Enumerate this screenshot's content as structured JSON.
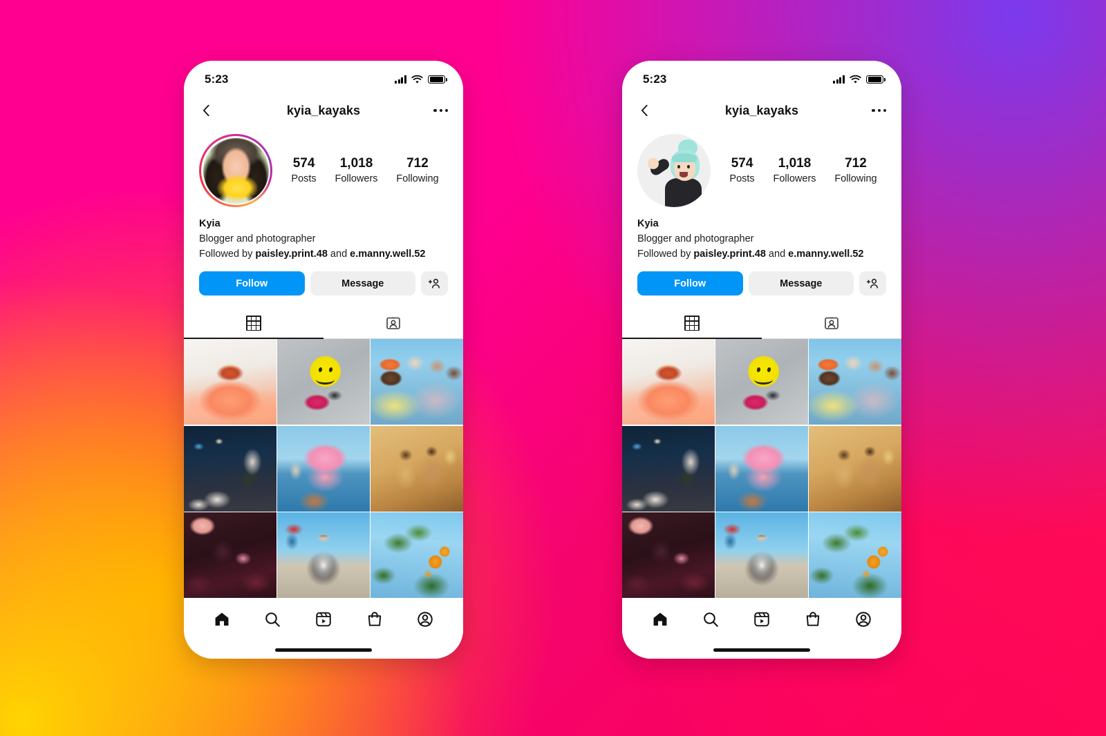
{
  "background": {
    "gradient_colors": [
      "#FF0090",
      "#7B3BEE",
      "#FF0055",
      "#FF8A00",
      "#FFD400"
    ]
  },
  "theme": {
    "follow_button_color": "#0095F6",
    "secondary_button_color": "#EFEFEF",
    "text_color": "#111111",
    "divider_color": "#DBDBDB"
  },
  "status_bar": {
    "time": "5:23",
    "signal_icon": "cellular-signal-icon",
    "wifi_icon": "wifi-icon",
    "battery_icon": "battery-full-icon"
  },
  "nav": {
    "back_icon": "back-chevron-icon",
    "username": "kyia_kayaks",
    "more_icon": "more-options-icon"
  },
  "profile": {
    "name": "Kyia",
    "description": "Blogger and photographer",
    "followed_by_prefix": "Followed by ",
    "followed_by_first": "paisley.print.48",
    "followed_by_joiner": " and ",
    "followed_by_second": "e.manny.well.52",
    "avatar_left": "profile-photo-avatar",
    "avatar_right": "profile-memoji-avatar",
    "has_story_ring_left": true,
    "has_story_ring_right": false
  },
  "stats": [
    {
      "value": "574",
      "label": "Posts"
    },
    {
      "value": "1,018",
      "label": "Followers"
    },
    {
      "value": "712",
      "label": "Following"
    }
  ],
  "actions": {
    "follow_label": "Follow",
    "message_label": "Message",
    "add_user_icon": "add-person-icon"
  },
  "tabs": [
    {
      "icon": "grid-icon",
      "name": "posts-grid-tab",
      "active": true
    },
    {
      "icon": "tagged-person-icon",
      "name": "tagged-tab",
      "active": false
    }
  ],
  "photo_grid": [
    {
      "name": "post-peach-puffer-coat-portrait"
    },
    {
      "name": "post-yellow-smiley-balloon"
    },
    {
      "name": "post-group-of-friends-outdoors"
    },
    {
      "name": "post-night-street-scene"
    },
    {
      "name": "post-pink-hoodie-waterfront"
    },
    {
      "name": "post-warm-toned-mirror-selfie"
    },
    {
      "name": "post-dark-floral-hand"
    },
    {
      "name": "post-gas-station-portrait"
    },
    {
      "name": "post-orange-tree-branch"
    }
  ],
  "bottom_nav": [
    {
      "icon": "home-icon",
      "name": "nav-home",
      "active": true
    },
    {
      "icon": "search-icon",
      "name": "nav-search",
      "active": false
    },
    {
      "icon": "reels-icon",
      "name": "nav-reels",
      "active": false
    },
    {
      "icon": "shop-icon",
      "name": "nav-shop",
      "active": false
    },
    {
      "icon": "profile-icon",
      "name": "nav-profile",
      "active": false
    }
  ]
}
